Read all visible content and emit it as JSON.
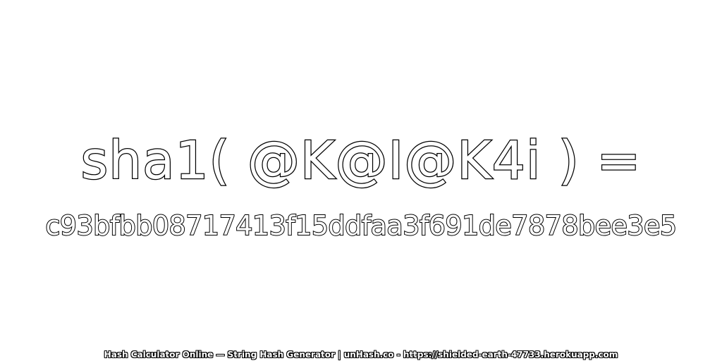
{
  "expression": "sha1( @K@I@K4i ) =",
  "digest": "c93bfbb08717413f15ddfaa3f691de7878bee3e5",
  "footer": "Hash Calculator Online — String Hash Generator | unHash.co - https://shielded-earth-47733.herokuapp.com",
  "colors": {
    "background": "#ffffff",
    "text_fill": "#ffffff",
    "text_outline": "#000000"
  }
}
